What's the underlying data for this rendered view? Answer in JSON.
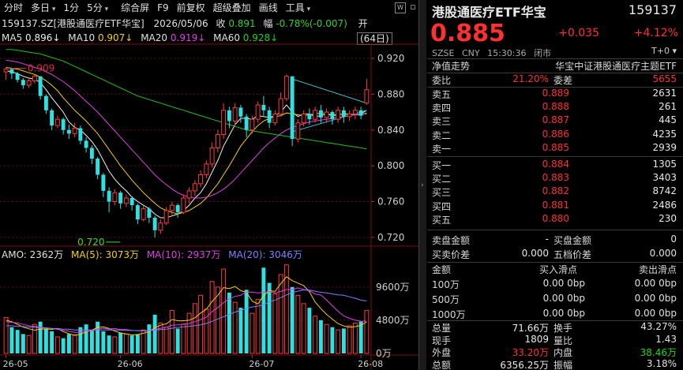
{
  "toolbar": {
    "items": [
      "分时",
      "多日",
      "1分",
      "5分",
      "综合屏",
      "F9",
      "前复权",
      "超级叠加",
      "画线",
      "工具"
    ],
    "dropdown_flags": [
      false,
      true,
      false,
      true,
      false,
      false,
      false,
      false,
      false,
      true
    ],
    "icons": [
      "fund-icon",
      "window-icon"
    ]
  },
  "info": {
    "code_name": "159137.SZ[港股通医疗ETF华宝]",
    "date": "2026/05/06",
    "close_label": "收",
    "close": "0.891",
    "range_label": "幅",
    "change": "-0.78%(-0.007)",
    "open_label": "开"
  },
  "ma": {
    "ma5_label": "MA5",
    "ma5": "0.896↓",
    "ma10_label": "MA10",
    "ma10": "0.907↓",
    "ma20_label": "MA20",
    "ma20": "0.919↓",
    "ma60_label": "MA60",
    "ma60": "0.928↓",
    "period": "(64日)"
  },
  "amo": {
    "text": "AMO: 2362万",
    "ma5": "MA(5): 3073万",
    "ma10": "MA(10): 2937万",
    "ma20": "MA(20): 3046万"
  },
  "chart_data": {
    "type": "candlestick",
    "price_axis_ticks": [
      "0.920",
      "0.880",
      "0.840",
      "0.800",
      "0.760",
      "0.720"
    ],
    "price_ylim": [
      0.712,
      0.935
    ],
    "volume_axis_ticks": [
      "9600万",
      "4800万",
      "0万"
    ],
    "volume_ylim": [
      0,
      13000
    ],
    "x_ticks": [
      "26-05",
      "26-06",
      "26-07",
      "26-08"
    ],
    "x_tick_index": [
      0,
      20,
      43,
      62
    ],
    "annotations": [
      {
        "label": "0.909",
        "index": 1,
        "value": 0.909
      },
      {
        "label": "0.720",
        "index": 18,
        "value": 0.72
      }
    ],
    "candles": [
      [
        0.905,
        0.908,
        0.91,
        0.896
      ],
      [
        0.908,
        0.903,
        0.909,
        0.897
      ],
      [
        0.903,
        0.896,
        0.905,
        0.893
      ],
      [
        0.896,
        0.89,
        0.898,
        0.886
      ],
      [
        0.89,
        0.895,
        0.899,
        0.887
      ],
      [
        0.895,
        0.9,
        0.902,
        0.892
      ],
      [
        0.9,
        0.878,
        0.9,
        0.874
      ],
      [
        0.878,
        0.862,
        0.88,
        0.858
      ],
      [
        0.862,
        0.845,
        0.864,
        0.84
      ],
      [
        0.845,
        0.852,
        0.856,
        0.842
      ],
      [
        0.852,
        0.84,
        0.854,
        0.835
      ],
      [
        0.84,
        0.836,
        0.846,
        0.83
      ],
      [
        0.836,
        0.842,
        0.848,
        0.832
      ],
      [
        0.842,
        0.828,
        0.845,
        0.824
      ],
      [
        0.828,
        0.82,
        0.832,
        0.815
      ],
      [
        0.82,
        0.808,
        0.823,
        0.802
      ],
      [
        0.808,
        0.79,
        0.81,
        0.785
      ],
      [
        0.79,
        0.772,
        0.792,
        0.765
      ],
      [
        0.772,
        0.76,
        0.776,
        0.748
      ],
      [
        0.76,
        0.77,
        0.774,
        0.756
      ],
      [
        0.77,
        0.758,
        0.772,
        0.752
      ],
      [
        0.758,
        0.764,
        0.768,
        0.754
      ],
      [
        0.764,
        0.756,
        0.766,
        0.75
      ],
      [
        0.756,
        0.74,
        0.758,
        0.735
      ],
      [
        0.74,
        0.752,
        0.756,
        0.738
      ],
      [
        0.752,
        0.742,
        0.754,
        0.736
      ],
      [
        0.742,
        0.728,
        0.744,
        0.72
      ],
      [
        0.728,
        0.736,
        0.74,
        0.724
      ],
      [
        0.736,
        0.75,
        0.754,
        0.734
      ],
      [
        0.75,
        0.756,
        0.76,
        0.745
      ],
      [
        0.756,
        0.748,
        0.758,
        0.742
      ],
      [
        0.748,
        0.764,
        0.768,
        0.746
      ],
      [
        0.764,
        0.772,
        0.776,
        0.758
      ],
      [
        0.772,
        0.78,
        0.784,
        0.766
      ],
      [
        0.78,
        0.79,
        0.795,
        0.776
      ],
      [
        0.79,
        0.802,
        0.806,
        0.786
      ],
      [
        0.802,
        0.82,
        0.826,
        0.798
      ],
      [
        0.82,
        0.835,
        0.84,
        0.815
      ],
      [
        0.835,
        0.862,
        0.87,
        0.83
      ],
      [
        0.862,
        0.85,
        0.866,
        0.842
      ],
      [
        0.85,
        0.865,
        0.87,
        0.845
      ],
      [
        0.865,
        0.855,
        0.868,
        0.848
      ],
      [
        0.855,
        0.84,
        0.858,
        0.832
      ],
      [
        0.84,
        0.852,
        0.856,
        0.836
      ],
      [
        0.852,
        0.868,
        0.872,
        0.848
      ],
      [
        0.868,
        0.862,
        0.878,
        0.856
      ],
      [
        0.862,
        0.848,
        0.866,
        0.842
      ],
      [
        0.848,
        0.858,
        0.862,
        0.845
      ],
      [
        0.858,
        0.875,
        0.882,
        0.855
      ],
      [
        0.875,
        0.9,
        0.902,
        0.872
      ],
      [
        0.9,
        0.83,
        0.9,
        0.822
      ],
      [
        0.83,
        0.848,
        0.852,
        0.826
      ],
      [
        0.848,
        0.858,
        0.862,
        0.844
      ],
      [
        0.858,
        0.852,
        0.864,
        0.846
      ],
      [
        0.852,
        0.862,
        0.866,
        0.848
      ],
      [
        0.862,
        0.854,
        0.868,
        0.848
      ],
      [
        0.854,
        0.86,
        0.864,
        0.848
      ],
      [
        0.86,
        0.852,
        0.862,
        0.846
      ],
      [
        0.852,
        0.862,
        0.866,
        0.848
      ],
      [
        0.862,
        0.855,
        0.866,
        0.848
      ],
      [
        0.855,
        0.858,
        0.862,
        0.85
      ],
      [
        0.858,
        0.862,
        0.866,
        0.852
      ],
      [
        0.862,
        0.856,
        0.866,
        0.852
      ],
      [
        0.87,
        0.885,
        0.897,
        0.868
      ]
    ],
    "ma_series": [
      {
        "name": "MA5",
        "color": "#f0f0f0",
        "values": [
          0.906,
          0.905,
          0.903,
          0.9,
          0.898,
          0.897,
          0.893,
          0.885,
          0.876,
          0.868,
          0.86,
          0.849,
          0.843,
          0.84,
          0.834,
          0.827,
          0.818,
          0.806,
          0.794,
          0.785,
          0.778,
          0.772,
          0.765,
          0.76,
          0.756,
          0.752,
          0.746,
          0.742,
          0.742,
          0.744,
          0.746,
          0.75,
          0.756,
          0.764,
          0.77,
          0.78,
          0.793,
          0.806,
          0.822,
          0.834,
          0.846,
          0.853,
          0.853,
          0.852,
          0.856,
          0.855,
          0.854,
          0.856,
          0.86,
          0.868,
          0.86,
          0.855,
          0.858,
          0.858,
          0.855,
          0.856,
          0.858,
          0.856,
          0.857,
          0.858,
          0.858,
          0.857,
          0.858,
          0.862
        ]
      },
      {
        "name": "MA10",
        "color": "#f5d000",
        "values": [
          0.91,
          0.909,
          0.908,
          0.906,
          0.904,
          0.902,
          0.899,
          0.895,
          0.89,
          0.884,
          0.876,
          0.869,
          0.862,
          0.856,
          0.85,
          0.843,
          0.836,
          0.827,
          0.818,
          0.809,
          0.8,
          0.792,
          0.784,
          0.777,
          0.77,
          0.764,
          0.758,
          0.753,
          0.75,
          0.748,
          0.746,
          0.748,
          0.75,
          0.754,
          0.758,
          0.764,
          0.772,
          0.78,
          0.79,
          0.8,
          0.811,
          0.822,
          0.83,
          0.838,
          0.845,
          0.85,
          0.853,
          0.855,
          0.856,
          0.859,
          0.858,
          0.857,
          0.856,
          0.857,
          0.858,
          0.859,
          0.858,
          0.857,
          0.857,
          0.858,
          0.857,
          0.857,
          0.857,
          0.859
        ]
      },
      {
        "name": "MA20",
        "color": "#e040e0",
        "values": [
          0.918,
          0.917,
          0.916,
          0.914,
          0.912,
          0.91,
          0.908,
          0.905,
          0.902,
          0.898,
          0.894,
          0.889,
          0.884,
          0.878,
          0.872,
          0.866,
          0.86,
          0.853,
          0.846,
          0.839,
          0.832,
          0.825,
          0.818,
          0.811,
          0.804,
          0.797,
          0.79,
          0.784,
          0.779,
          0.774,
          0.77,
          0.767,
          0.765,
          0.764,
          0.764,
          0.765,
          0.767,
          0.77,
          0.774,
          0.779,
          0.785,
          0.792,
          0.799,
          0.806,
          0.813,
          0.82,
          0.826,
          0.831,
          0.836,
          0.84,
          0.843,
          0.845,
          0.847,
          0.849,
          0.85,
          0.851,
          0.852,
          0.853,
          0.854,
          0.855,
          0.856,
          0.857,
          0.858,
          0.858
        ]
      },
      {
        "name": "MA60",
        "color": "#20c020",
        "values": [
          0.93,
          0.93,
          0.929,
          0.928,
          0.927,
          0.926,
          0.925,
          0.923,
          0.921,
          0.919,
          0.917,
          0.914,
          0.911,
          0.908,
          0.905,
          0.902,
          0.899,
          0.896,
          0.893,
          0.89,
          0.887,
          0.884,
          0.881,
          0.878,
          0.876,
          0.874,
          0.872,
          0.87,
          0.868,
          0.866,
          0.864,
          0.862,
          0.86,
          0.858,
          0.856,
          0.854,
          0.852,
          0.85,
          0.848,
          0.846,
          0.844,
          0.842,
          0.84,
          0.839,
          0.838,
          0.837,
          0.836,
          0.835,
          0.834,
          0.833,
          0.832,
          0.831,
          0.83,
          0.829,
          0.828,
          0.827,
          0.826,
          0.825,
          0.824,
          0.823,
          0.822,
          0.821,
          0.82,
          0.819
        ]
      }
    ],
    "trend_lines": [
      {
        "from": [
          50,
          0.897
        ],
        "to": [
          63,
          0.87
        ],
        "color": "#40c0d0"
      },
      {
        "from": [
          50,
          0.838
        ],
        "to": [
          63,
          0.862
        ],
        "color": "#40c0d0"
      }
    ],
    "volume": [
      5200,
      3800,
      3400,
      2800,
      2600,
      4200,
      4600,
      3600,
      3200,
      2400,
      2200,
      2800,
      2600,
      3800,
      4200,
      3400,
      4600,
      3200,
      2600,
      2400,
      3000,
      2800,
      2600,
      2800,
      3400,
      4200,
      5600,
      4400,
      3800,
      6200,
      3600,
      4200,
      5800,
      7200,
      8400,
      6400,
      10400,
      9600,
      12200,
      8800,
      7400,
      6600,
      9200,
      5800,
      7800,
      12400,
      10200,
      8600,
      11400,
      12800,
      9600,
      8400,
      7200,
      6600,
      5400,
      4800,
      4200,
      3800,
      3400,
      3600,
      4000,
      4400,
      4600,
      6200
    ],
    "volume_ma": [
      {
        "name": "MA(5)",
        "color": "#f5d000",
        "values": [
          4800,
          4600,
          4200,
          3800,
          3560,
          3360,
          3520,
          3540,
          3480,
          3600,
          3160,
          2840,
          2640,
          2760,
          3120,
          3360,
          3760,
          3840,
          3600,
          3240,
          2960,
          2800,
          2680,
          2720,
          2920,
          3160,
          3720,
          4080,
          4280,
          4920,
          4720,
          4720,
          4800,
          5160,
          5840,
          6400,
          7520,
          8400,
          9520,
          9360,
          9680,
          9080,
          8840,
          7560,
          7160,
          8360,
          9080,
          8960,
          10080,
          11080,
          10520,
          10160,
          9800,
          8920,
          7440,
          6480,
          5640,
          4960,
          4320,
          3960,
          3800,
          3880,
          4060,
          4560
        ]
      },
      {
        "name": "MA(10)",
        "color": "#e040e0",
        "values": [
          4600,
          4500,
          4400,
          4200,
          4000,
          3900,
          3800,
          3700,
          3600,
          3480,
          3340,
          3200,
          3060,
          3060,
          3240,
          3260,
          3520,
          3640,
          3540,
          3600,
          3440,
          3440,
          3320,
          3300,
          3280,
          3300,
          3460,
          3640,
          3800,
          4080,
          4140,
          4240,
          4320,
          4600,
          4880,
          5240,
          6060,
          6640,
          7340,
          7880,
          8240,
          8400,
          8860,
          8860,
          8740,
          8860,
          8960,
          8740,
          8960,
          9240,
          9240,
          9460,
          9240,
          9060,
          8600,
          8440,
          7720,
          6900,
          6100,
          5420,
          5080,
          4800,
          4640,
          4660
        ]
      },
      {
        "name": "MA(20)",
        "color": "#8080ff",
        "values": [
          4000,
          4000,
          3900,
          3900,
          3800,
          3800,
          3700,
          3700,
          3600,
          3600,
          3500,
          3500,
          3400,
          3400,
          3400,
          3400,
          3400,
          3400,
          3400,
          3400,
          3360,
          3340,
          3320,
          3300,
          3280,
          3300,
          3380,
          3440,
          3500,
          3640,
          3780,
          3860,
          3920,
          4020,
          4140,
          4340,
          4640,
          4980,
          5300,
          5640,
          5980,
          6220,
          6500,
          6720,
          6840,
          7040,
          7460,
          7720,
          8060,
          8460,
          8820,
          9000,
          9180,
          9140,
          9000,
          8840,
          8760,
          8600,
          8460,
          8400,
          8180,
          7980,
          7700,
          7600
        ]
      }
    ]
  },
  "panel": {
    "name": "港股通医疗ETF华宝",
    "code": "159137",
    "price": "0.885",
    "change": "+0.035",
    "pct": "+4.12%",
    "meta": [
      "SZSE",
      "CNY",
      "15:30:36",
      "闭市"
    ],
    "t0": "T+0 ▾",
    "nav_label": "净值走势",
    "index_name": "华宝中证港股通医疗主题ETF",
    "wb_label": "委比",
    "wb": "21.20%",
    "wc_label": "委差",
    "wc": "5655",
    "sell": [
      {
        "label": "卖五",
        "price": "0.889",
        "vol": "2631"
      },
      {
        "label": "卖四",
        "price": "0.888",
        "vol": "261"
      },
      {
        "label": "卖三",
        "price": "0.887",
        "vol": "445"
      },
      {
        "label": "卖二",
        "price": "0.886",
        "vol": "4235"
      },
      {
        "label": "卖一",
        "price": "0.885",
        "vol": "2939"
      }
    ],
    "buy": [
      {
        "label": "买一",
        "price": "0.884",
        "vol": "1305"
      },
      {
        "label": "买二",
        "price": "0.883",
        "vol": "3403"
      },
      {
        "label": "买三",
        "price": "0.882",
        "vol": "8742"
      },
      {
        "label": "买四",
        "price": "0.881",
        "vol": "2486"
      },
      {
        "label": "买五",
        "price": "0.880",
        "vol": "230"
      }
    ],
    "sell_amount_label": "卖盘金额",
    "sell_amount": "-",
    "buy_amount_label": "买盘金额",
    "buy_amount": "0",
    "spread_label": "买卖价差",
    "spread": "0.000",
    "five_spread_label": "五档价差",
    "five_spread": "0.000",
    "slip_head": [
      "金额",
      "买入滑点",
      "卖出滑点"
    ],
    "slip": [
      {
        "amt": "100万",
        "b1": "0.00",
        "b2": "0bp",
        "s1": "0.00",
        "s2": "0bp"
      },
      {
        "amt": "500万",
        "b1": "0.00",
        "b2": "0bp",
        "s1": "0.00",
        "s2": "0bp"
      },
      {
        "amt": "1000万",
        "b1": "0.00",
        "b2": "0bp",
        "s1": "0.00",
        "s2": "0bp"
      }
    ],
    "stats": [
      {
        "l1": "总量",
        "v1": "71.66万",
        "l2": "换手",
        "v2": "43.27%",
        "c1": "white",
        "c2": "white"
      },
      {
        "l1": "现手",
        "v1": "1809",
        "l2": "量比",
        "v2": "1.43",
        "c1": "white",
        "c2": "white"
      },
      {
        "l1": "外盘",
        "v1": "33.20万",
        "l2": "内盘",
        "v2": "38.46万",
        "c1": "red",
        "c2": "green"
      },
      {
        "l1": "总额",
        "v1": "6356.25万",
        "l2": "振幅",
        "v2": "3.18%",
        "c1": "white",
        "c2": "white"
      }
    ]
  }
}
